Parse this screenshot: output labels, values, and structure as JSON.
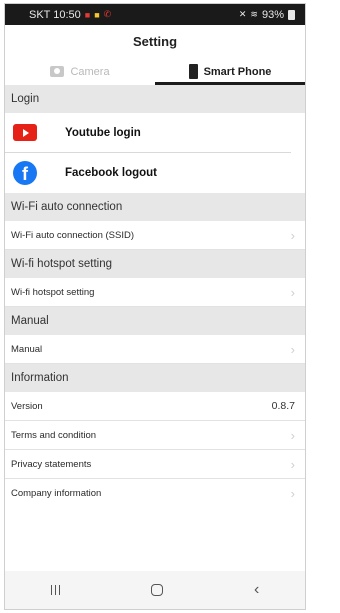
{
  "status_bar": {
    "carrier_time": "SKT 10:50",
    "battery": "93%"
  },
  "header": {
    "title": "Setting"
  },
  "tabs": [
    {
      "label": "Camera",
      "icon": "camera-icon"
    },
    {
      "label": "Smart Phone",
      "icon": "smartphone-icon"
    }
  ],
  "sections": {
    "login": {
      "title": "Login",
      "youtube": "Youtube login",
      "facebook": "Facebook logout"
    },
    "wifi_auto": {
      "title": "Wi-Fi auto connection",
      "item": "Wi-Fi auto connection (SSID)"
    },
    "hotspot": {
      "title": "Wi-fi hotspot setting",
      "item": "Wi-fi hotspot setting"
    },
    "manual": {
      "title": "Manual",
      "item": "Manual"
    },
    "information": {
      "title": "Information",
      "version_label": "Version",
      "version_value": "0.8.7",
      "terms": "Terms and condition",
      "privacy": "Privacy statements",
      "company": "Company information"
    }
  },
  "colors": {
    "accent": "#1c1c1c",
    "section_bg": "#e7e7e7",
    "youtube": "#e62117",
    "facebook": "#1877f2"
  }
}
